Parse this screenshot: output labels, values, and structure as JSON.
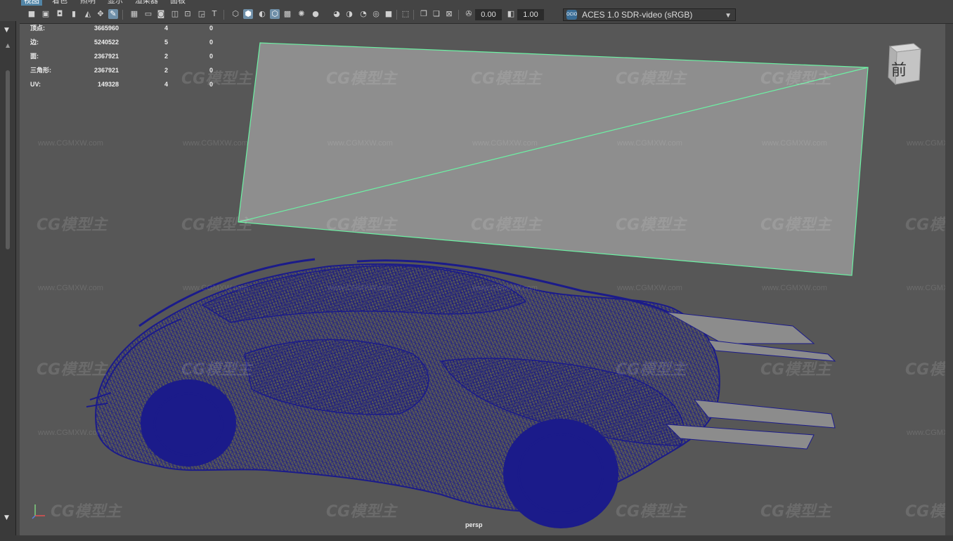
{
  "menu": [
    "视图",
    "着色",
    "照明",
    "显示",
    "渲染器",
    "面板"
  ],
  "toolbar": {
    "exposure_value": "0.00",
    "gamma_value": "1.00",
    "colorspace": "ACES 1.0 SDR-video (sRGB)",
    "ocio_badge": "OCIO"
  },
  "hud": {
    "rows": [
      {
        "label": "顶点:",
        "v1": "3665960",
        "v2": "4",
        "v3": "0"
      },
      {
        "label": "边:",
        "v1": "5240522",
        "v2": "5",
        "v3": "0"
      },
      {
        "label": "面:",
        "v1": "2367921",
        "v2": "2",
        "v3": "0"
      },
      {
        "label": "三角形:",
        "v1": "2367921",
        "v2": "2",
        "v3": "0"
      },
      {
        "label": "UV:",
        "v1": "149328",
        "v2": "4",
        "v3": "0"
      }
    ]
  },
  "viewcube": {
    "face": "前"
  },
  "camera_label": "persp",
  "watermark": {
    "logo": "CG模型主",
    "url": "www.CGMXW.com"
  },
  "colors": {
    "viewport_bg": "#575757",
    "wire": "#1b1b8a",
    "plane": "#8e8e8e",
    "plane_edge": "#6cf2a4",
    "active_menu": "#5285a6"
  },
  "icons": [
    "camera-icon",
    "camera-lock-icon",
    "bookmark-icon",
    "grid-icon",
    "wireframe-icon",
    "smooth-shade-icon",
    "texture-icon",
    "light-icon",
    "shadow-icon",
    "isolate-icon",
    "xray-icon",
    "exposure-icon",
    "gamma-icon"
  ]
}
